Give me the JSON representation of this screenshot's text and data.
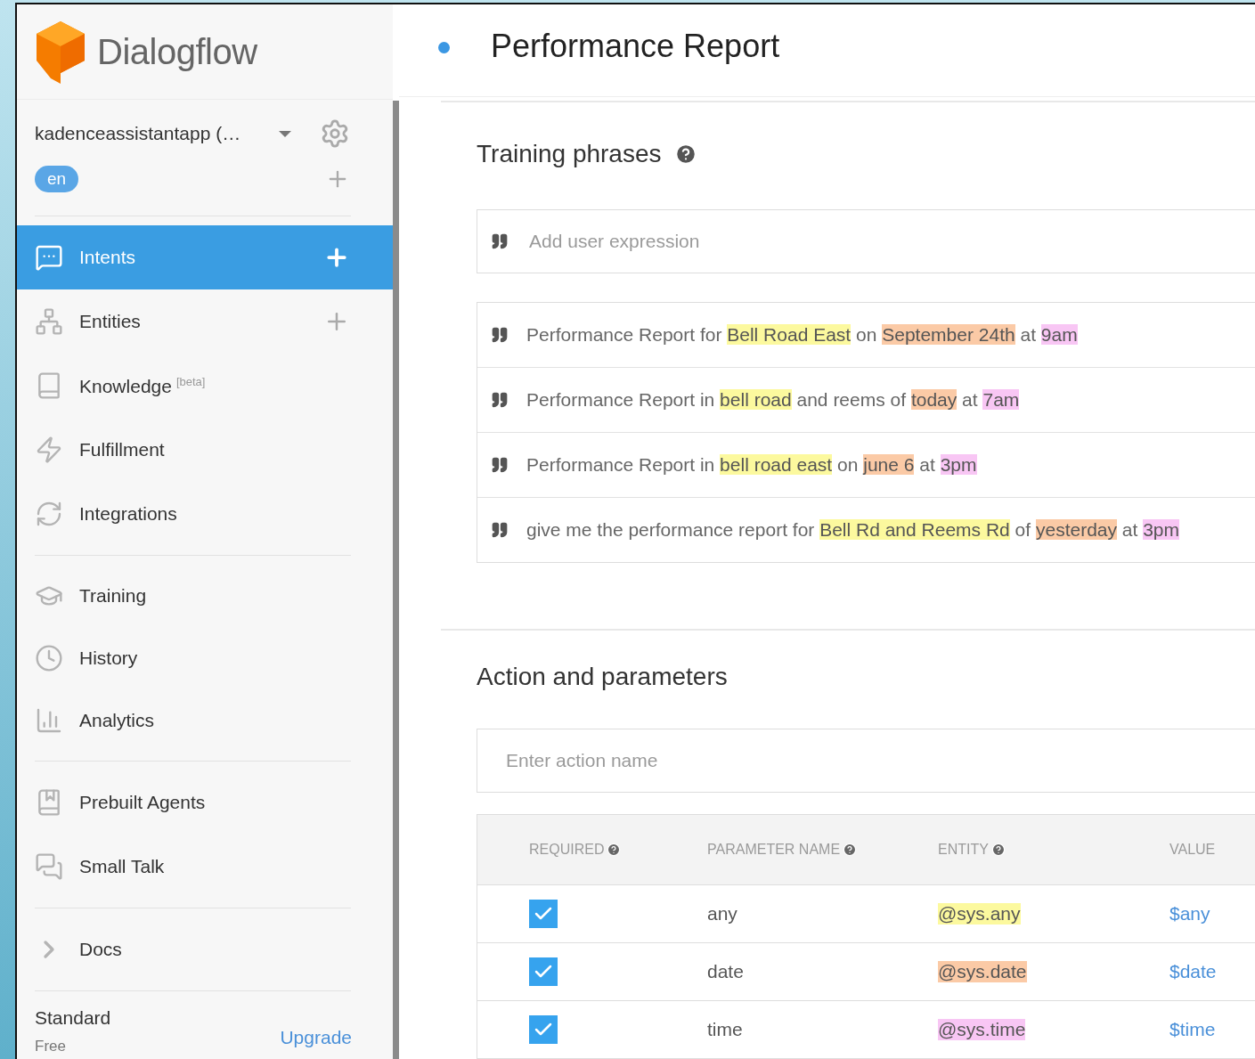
{
  "sidebar": {
    "brand": "Dialogflow",
    "agent": {
      "name": "kadenceassistantapp (…",
      "language": "en"
    },
    "groups": [
      {
        "items": [
          {
            "label": "Intents",
            "selected": true,
            "addable": true
          },
          {
            "label": "Entities",
            "selected": false,
            "addable": true
          },
          {
            "label": "Knowledge",
            "badge": "[beta]",
            "selected": false,
            "addable": false
          },
          {
            "label": "Fulfillment",
            "selected": false,
            "addable": false
          },
          {
            "label": "Integrations",
            "selected": false,
            "addable": false
          }
        ]
      },
      {
        "items": [
          {
            "label": "Training",
            "selected": false,
            "addable": false
          },
          {
            "label": "History",
            "selected": false,
            "addable": false
          },
          {
            "label": "Analytics",
            "selected": false,
            "addable": false
          }
        ]
      },
      {
        "items": [
          {
            "label": "Prebuilt Agents",
            "selected": false,
            "addable": false
          },
          {
            "label": "Small Talk",
            "selected": false,
            "addable": false
          }
        ]
      },
      {
        "items": [
          {
            "label": "Docs",
            "selected": false,
            "addable": false
          }
        ]
      }
    ],
    "plan": {
      "name": "Standard",
      "tier": "Free",
      "action": "Upgrade"
    }
  },
  "header": {
    "title": "Performance Report"
  },
  "training_phrases": {
    "title": "Training phrases",
    "placeholder": "Add user expression",
    "phrases": [
      {
        "parts": [
          {
            "text": "Performance Report for "
          },
          {
            "text": "Bell Road East",
            "color": "#fcf99e"
          },
          {
            "text": " on "
          },
          {
            "text": "September 24th",
            "color": "#fbcaa6"
          },
          {
            "text": " at "
          },
          {
            "text": "9am",
            "color": "#f8c6f4"
          }
        ]
      },
      {
        "parts": [
          {
            "text": "Performance Report in "
          },
          {
            "text": "bell road",
            "color": "#fcf99e"
          },
          {
            "text": " and reems of "
          },
          {
            "text": "today",
            "color": "#fbcaa6"
          },
          {
            "text": " at "
          },
          {
            "text": "7am",
            "color": "#f8c6f4"
          }
        ]
      },
      {
        "parts": [
          {
            "text": "Performance Report in "
          },
          {
            "text": "bell road east",
            "color": "#fcf99e"
          },
          {
            "text": " on "
          },
          {
            "text": "june 6",
            "color": "#fbcaa6"
          },
          {
            "text": " at "
          },
          {
            "text": "3pm",
            "color": "#f8c6f4"
          }
        ]
      },
      {
        "parts": [
          {
            "text": "give me the performance report for "
          },
          {
            "text": "Bell Rd and Reems Rd",
            "color": "#fcf99e"
          },
          {
            "text": " of "
          },
          {
            "text": "yesterday",
            "color": "#fbcaa6"
          },
          {
            "text": " at "
          },
          {
            "text": "3pm",
            "color": "#f8c6f4"
          }
        ]
      }
    ]
  },
  "action": {
    "title": "Action and parameters",
    "placeholder": "Enter action name",
    "columns": [
      {
        "label": "REQUIRED",
        "help": true
      },
      {
        "label": "PARAMETER NAME",
        "help": true
      },
      {
        "label": "ENTITY",
        "help": true
      },
      {
        "label": "VALUE",
        "help": false
      }
    ],
    "rows": [
      {
        "required": true,
        "name": "any",
        "entity": "@sys.any",
        "color": "#fcf99e",
        "value": "$any"
      },
      {
        "required": true,
        "name": "date",
        "entity": "@sys.date",
        "color": "#fbcaa6",
        "value": "$date"
      },
      {
        "required": true,
        "name": "time",
        "entity": "@sys.time",
        "color": "#f8c6f4",
        "value": "$time"
      }
    ]
  }
}
